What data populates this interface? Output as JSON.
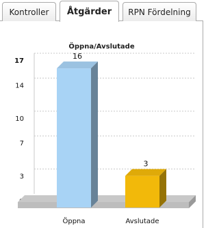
{
  "tabs": [
    {
      "label": "Kontroller",
      "active": false
    },
    {
      "label": "Åtgärder",
      "active": true
    },
    {
      "label": "RPN Fördelning",
      "active": false
    }
  ],
  "chart_data": {
    "type": "bar",
    "title": "Öppna/Avslutade",
    "categories": [
      "Öppna",
      "Avslutade"
    ],
    "values": [
      16,
      3
    ],
    "data_labels": [
      "16",
      "3"
    ],
    "colors": [
      "#a8d3f5",
      "#f2b90a"
    ],
    "yticks": [
      0,
      3,
      7,
      10,
      14,
      17
    ],
    "ytick_labels": [
      "0",
      "3",
      "7",
      "10",
      "14",
      "17"
    ],
    "ylim": [
      0,
      17
    ],
    "grid": true,
    "xlabel": "",
    "ylabel": ""
  }
}
